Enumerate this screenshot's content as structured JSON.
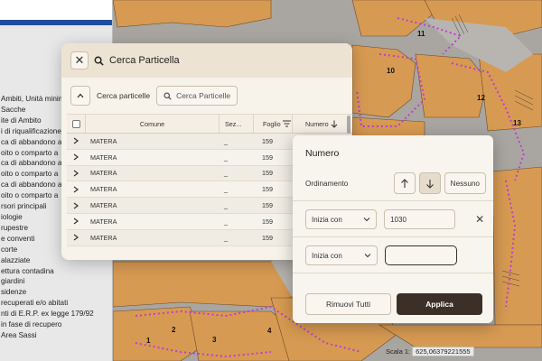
{
  "legend": {
    "items": [
      "Ambiti, Unità minim",
      "",
      "Sacche",
      "ite di Ambito",
      "i di riqualificazione",
      "ca di abbandono a",
      "oito o comparto a",
      "ca di abbandono a",
      "oito o comparto a",
      "ca di abbandono a",
      "oito o comparto a",
      "rsori principali",
      "iologie",
      "rupestre",
      "e conventi",
      "",
      "corte",
      "alazziate",
      "ettura contadina",
      "giardini",
      "sidenze",
      "recuperati e/o abitati",
      "nti di E.R.P. ex legge 179/92",
      "in fase di recupero",
      "Area Sassi"
    ]
  },
  "map": {
    "labels": [
      "11",
      "10",
      "12",
      "13",
      "1",
      "2",
      "3",
      "4"
    ]
  },
  "dialog": {
    "title": "Cerca Particella",
    "toolbar_label": "Cerca particelle",
    "search_button": "Cerca Particelle",
    "columns": {
      "comune": "Comune",
      "sezione": "Sez...",
      "foglio": "Foglio",
      "numero": "Numero"
    },
    "rows": [
      {
        "comune": "MATERA",
        "sezione": "_",
        "foglio": "159"
      },
      {
        "comune": "MATERA",
        "sezione": "_",
        "foglio": "159"
      },
      {
        "comune": "MATERA",
        "sezione": "_",
        "foglio": "159"
      },
      {
        "comune": "MATERA",
        "sezione": "_",
        "foglio": "159"
      },
      {
        "comune": "MATERA",
        "sezione": "_",
        "foglio": "159"
      },
      {
        "comune": "MATERA",
        "sezione": "_",
        "foglio": "159"
      },
      {
        "comune": "MATERA",
        "sezione": "_",
        "foglio": "159"
      }
    ]
  },
  "filter": {
    "title": "Numero",
    "sort_label": "Ordinamento",
    "sort_none": "Nessuno",
    "conditions": [
      {
        "operator": "Inizia con",
        "value": "1030"
      },
      {
        "operator": "Inizia con",
        "value": ""
      }
    ],
    "remove_all": "Rimuovi Tutti",
    "apply": "Applica"
  },
  "scale": {
    "label": "Scala 1:",
    "value": "625,06379221555"
  },
  "colors": {
    "accent_dark": "#3b2f27",
    "parcel": "#d79a52",
    "boundary": "#c23bd1"
  }
}
